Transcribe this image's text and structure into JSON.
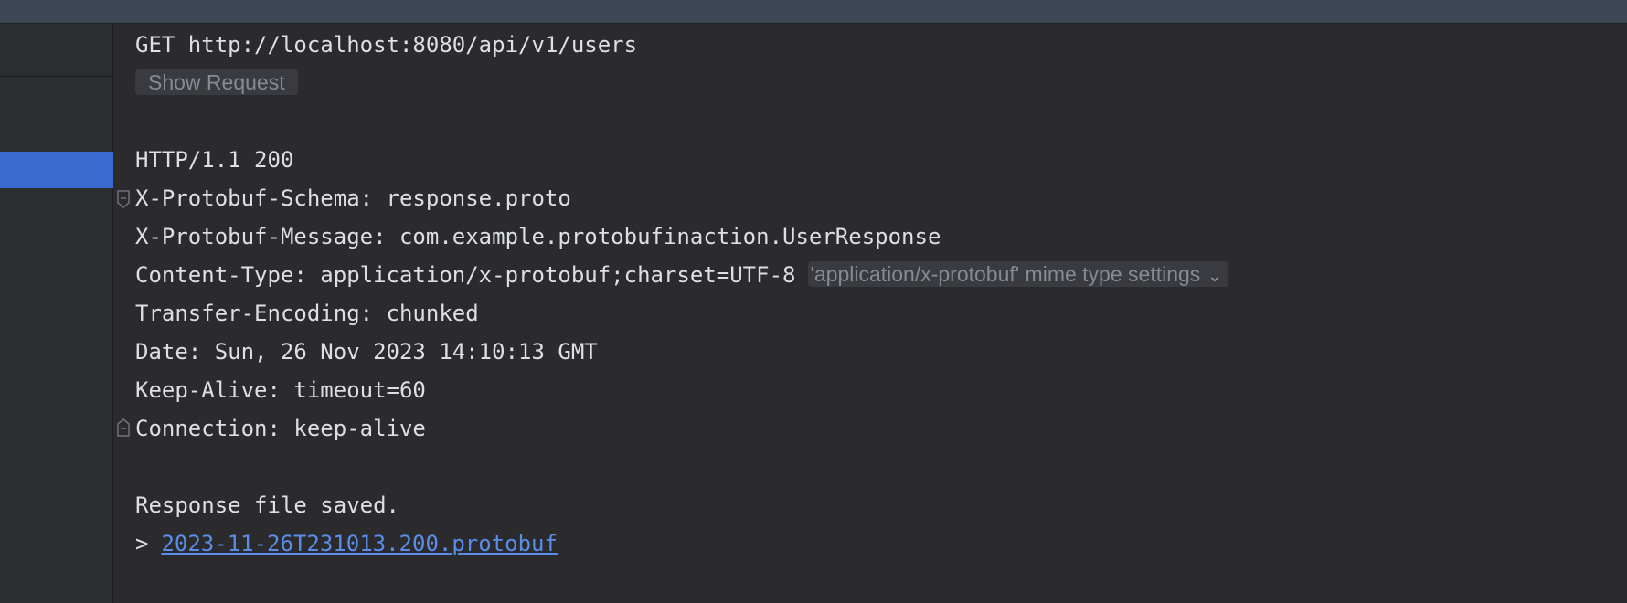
{
  "request": {
    "line": "GET http://localhost:8080/api/v1/users",
    "show_request_label": "Show Request"
  },
  "response": {
    "status_line": "HTTP/1.1 200",
    "headers": [
      "X-Protobuf-Schema: response.proto",
      "X-Protobuf-Message: com.example.protobufinaction.UserResponse",
      "Content-Type: application/x-protobuf;charset=UTF-8",
      "Transfer-Encoding: chunked",
      "Date: Sun, 26 Nov 2023 14:10:13 GMT",
      "Keep-Alive: timeout=60",
      "Connection: keep-alive"
    ],
    "mime_settings_label": "'application/x-protobuf' mime type settings",
    "saved_message": "Response file saved.",
    "saved_file_arrow": ">",
    "saved_file_name": "2023-11-26T231013.200.protobuf"
  },
  "icons": {
    "fold_start": "fold-start-icon",
    "fold_end": "fold-end-icon",
    "mime_dropdown": "chevron-down-icon"
  },
  "colors": {
    "editor_bg": "#2b2b2d",
    "text": "#dcdfe4",
    "selection": "#3b6bd1",
    "link": "#5a8de8",
    "inlay_bg": "#393b40",
    "inlay_text": "#868a91"
  }
}
